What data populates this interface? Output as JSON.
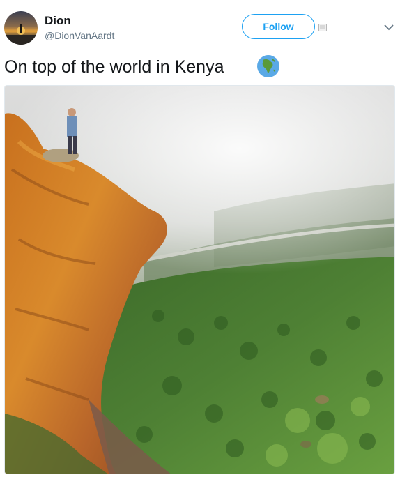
{
  "user": {
    "display_name": "Dion",
    "handle": "@DionVanAardt",
    "avatar_icon": "sunset-avatar"
  },
  "actions": {
    "follow_label": "Follow",
    "more_icon": "chevron-down-icon"
  },
  "tweet": {
    "text": "On top of the world in Kenya",
    "emoji_icon": "globe-africa-icon"
  },
  "colors": {
    "accent": "#1da1f2",
    "text_primary": "#14171a",
    "text_secondary": "#657786"
  }
}
